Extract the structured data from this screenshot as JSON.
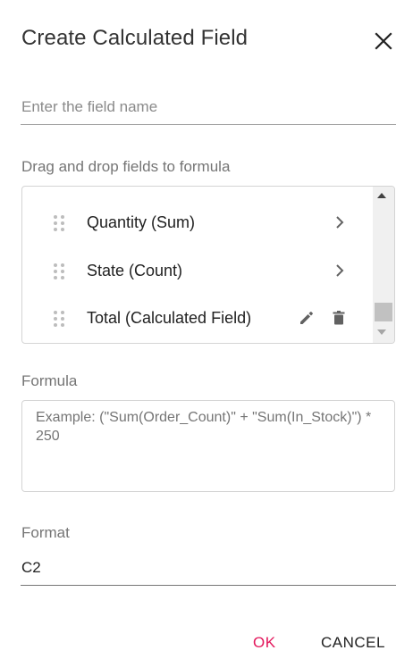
{
  "dialog": {
    "title": "Create Calculated Field",
    "close_icon": "close-icon"
  },
  "field_name": {
    "value": "",
    "placeholder": "Enter the field name"
  },
  "field_list": {
    "label": "Drag and drop fields to formula",
    "items": [
      {
        "label": "Quantity (Sum)",
        "action_icon": "chevron-right-icon"
      },
      {
        "label": "State (Count)",
        "action_icon": "chevron-right-icon"
      },
      {
        "label": "Total (Calculated Field)",
        "action_icons": [
          "edit-icon",
          "delete-icon"
        ]
      }
    ]
  },
  "formula": {
    "label": "Formula",
    "value": "",
    "placeholder": "Example: (\"Sum(Order_Count)\" + \"Sum(In_Stock)\") * 250"
  },
  "format": {
    "label": "Format",
    "value": "C2"
  },
  "buttons": {
    "ok": "OK",
    "cancel": "CANCEL"
  },
  "colors": {
    "accent": "#e3165b",
    "text": "#212121",
    "muted": "#757575",
    "border": "#d4d4d4"
  }
}
